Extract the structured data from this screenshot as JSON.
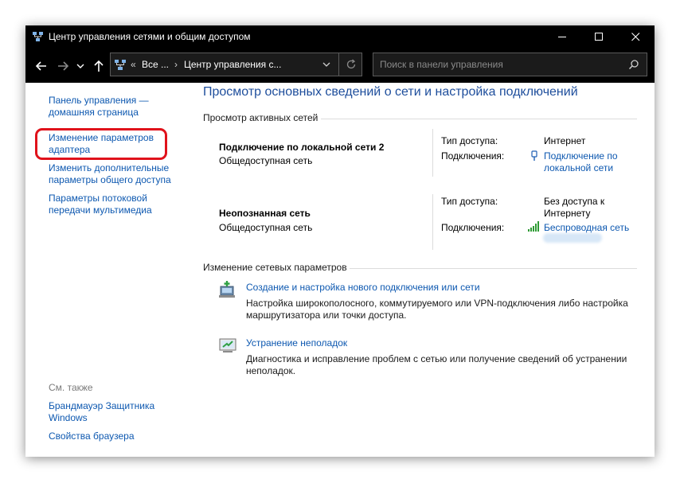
{
  "window": {
    "title": "Центр управления сетями и общим доступом"
  },
  "address": {
    "overflow": "«",
    "crumb1": "Все ...",
    "crumb2": "Центр управления с...",
    "separator": "›"
  },
  "search": {
    "placeholder": "Поиск в панели управления"
  },
  "sidebar": {
    "home_line1": "Панель управления —",
    "home_line2": "домашняя страница",
    "adapter_line1": "Изменение параметров",
    "adapter_line2": "адаптера",
    "sharing_line1": "Изменить дополнительные",
    "sharing_line2": "параметры общего доступа",
    "media_line1": "Параметры потоковой",
    "media_line2": "передачи мультимедиа",
    "see_also": "См. также",
    "firewall_line1": "Брандмауэр Защитника",
    "firewall_line2": "Windows",
    "browser": "Свойства браузера"
  },
  "main": {
    "title": "Просмотр основных сведений о сети и настройка подключений",
    "active_networks": "Просмотр активных сетей",
    "networks": [
      {
        "name": "Подключение по локальной сети 2",
        "category": "Общедоступная сеть",
        "access_label": "Тип доступа:",
        "access_line1": "Интернет",
        "access_line2": "",
        "conn_label": "Подключения:",
        "conn_line1": "Подключение по",
        "conn_line2": "локальной сети"
      },
      {
        "name": "Неопознанная сеть",
        "category": "Общедоступная сеть",
        "access_label": "Тип доступа:",
        "access_line1": "Без доступа к",
        "access_line2": "Интернету",
        "conn_label": "Подключения:",
        "conn_line1": "Беспроводная сеть",
        "conn_line2": ""
      }
    ],
    "change_settings": "Изменение сетевых параметров",
    "tasks": [
      {
        "title": "Создание и настройка нового подключения или сети",
        "desc_line1": "Настройка широкополосного, коммутируемого или VPN-подключения либо настройка",
        "desc_line2": "маршрутизатора или точки доступа."
      },
      {
        "title": "Устранение неполадок",
        "desc_line1": "Диагностика и исправление проблем с сетью или получение сведений об устранении",
        "desc_line2": "неполадок."
      }
    ]
  },
  "colors": {
    "titlebar": "#000000",
    "link": "#0d58b0",
    "title_blue": "#1e4e9c",
    "highlight": "#e0121b"
  },
  "icons": [
    "network-center-icon",
    "minimize-icon",
    "maximize-icon",
    "close-icon",
    "back-arrow-icon",
    "forward-arrow-icon",
    "recent-dropdown-icon",
    "up-arrow-icon",
    "refresh-icon",
    "search-icon",
    "ethernet-icon",
    "wifi-signal-icon",
    "new-connection-icon",
    "troubleshoot-icon"
  ]
}
